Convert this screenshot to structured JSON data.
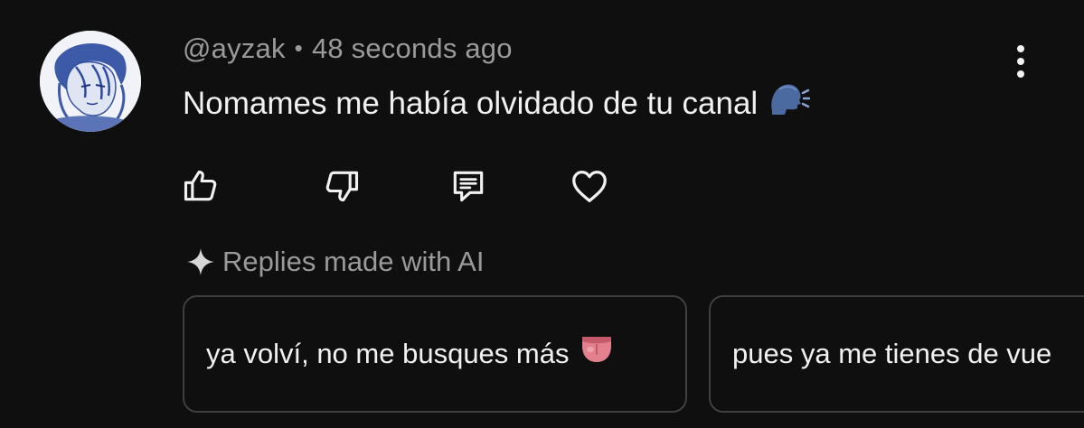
{
  "comment": {
    "author": "@ayzak",
    "separator": "•",
    "time": "48 seconds ago",
    "text": "Nomames me había olvidado de tu canal",
    "text_emoji_icon": "speaking-head-icon"
  },
  "menu": {
    "icon": "more-vertical-icon"
  },
  "actions": [
    {
      "name": "like",
      "icon": "thumbs-up-icon"
    },
    {
      "name": "dislike",
      "icon": "thumbs-down-icon"
    },
    {
      "name": "reply",
      "icon": "comment-icon"
    },
    {
      "name": "heart",
      "icon": "heart-icon"
    }
  ],
  "ai_replies": {
    "label": "Replies made with AI",
    "icon": "sparkle-icon",
    "suggestions": [
      {
        "text": "ya volví, no me busques más",
        "emoji_icon": "tongue-icon"
      },
      {
        "text": "pues ya me tienes de vue"
      }
    ]
  },
  "colors": {
    "background": "#0f0f0f",
    "primary_text": "#f1f1f1",
    "secondary_text": "#9a9a9a",
    "chip_border": "#3f3f3f"
  }
}
